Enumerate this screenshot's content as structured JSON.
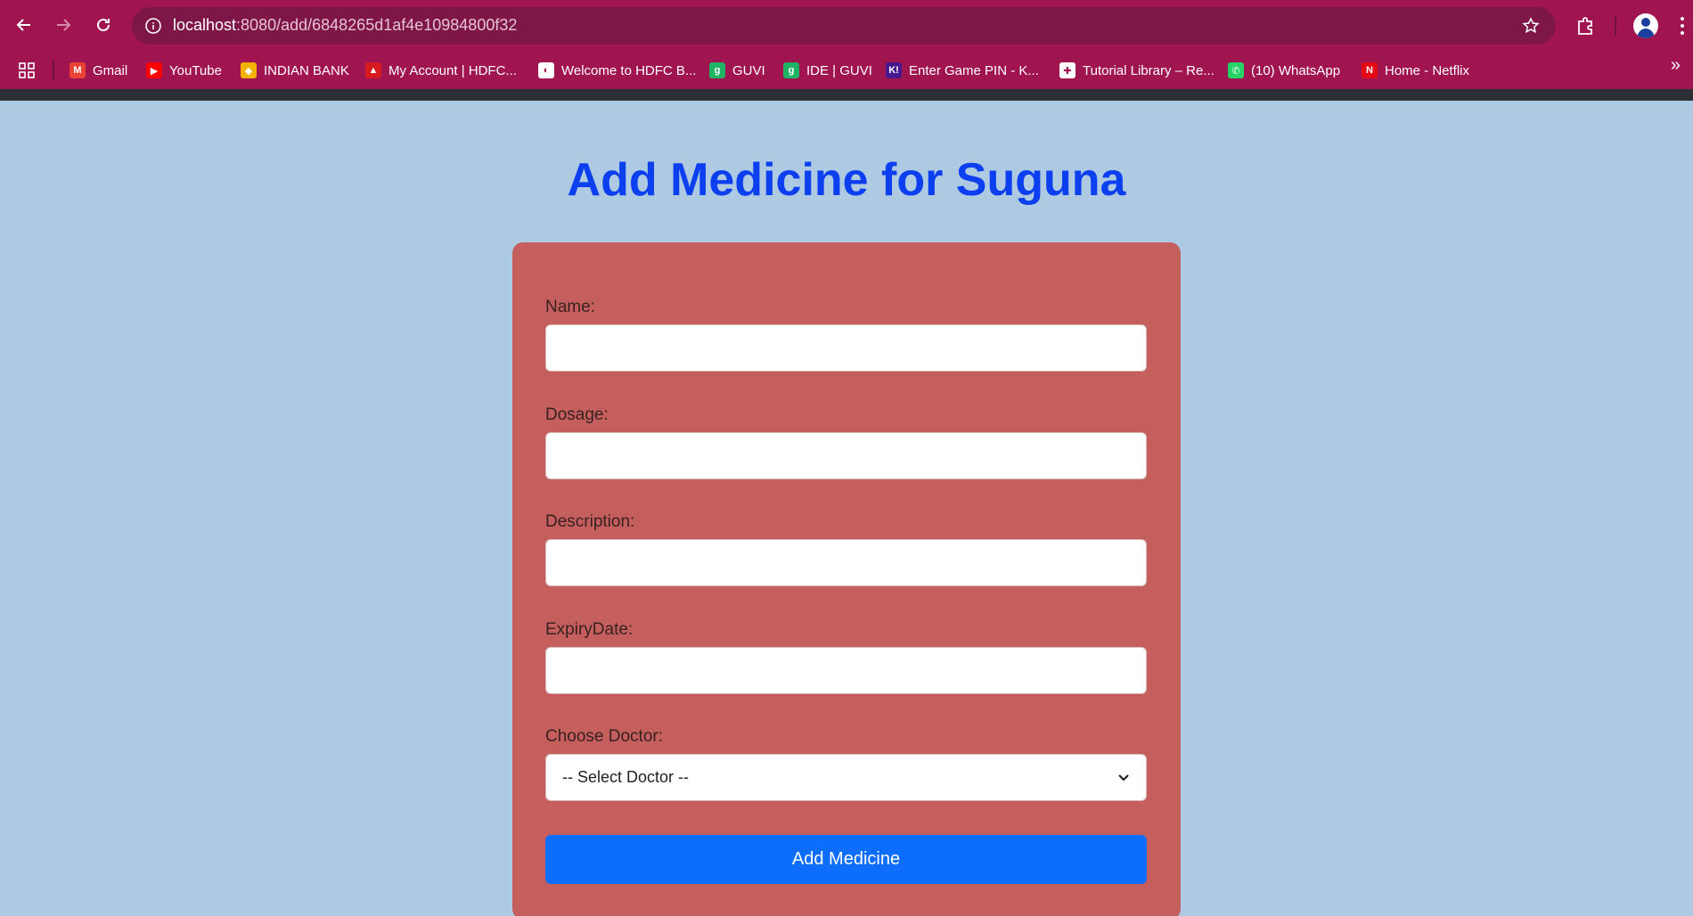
{
  "browser": {
    "url_host": "localhost",
    "url_rest": ":8080/add/6848265d1af4e10984800f32",
    "bookmarks": [
      {
        "label": "Gmail",
        "icon": "gmail-icon",
        "color": "#ea4335",
        "glyph": "M"
      },
      {
        "label": "YouTube",
        "icon": "youtube-icon",
        "color": "#ff0000",
        "glyph": "▶"
      },
      {
        "label": "INDIAN BANK",
        "icon": "indian-bank-icon",
        "color": "#f2b300",
        "glyph": "◆"
      },
      {
        "label": "My Account | HDFC...",
        "icon": "hdfc-icon",
        "color": "#d71920",
        "glyph": "▲"
      },
      {
        "label": "Welcome to HDFC B...",
        "icon": "globe-icon",
        "color": "#ffffff",
        "glyph": "◐"
      },
      {
        "label": "GUVI",
        "icon": "guvi-icon",
        "color": "#1fb463",
        "glyph": "g"
      },
      {
        "label": "IDE | GUVI",
        "icon": "guvi-icon",
        "color": "#1fb463",
        "glyph": "g"
      },
      {
        "label": "Enter Game PIN - K...",
        "icon": "kahoot-icon",
        "color": "#46178f",
        "glyph": "K!"
      },
      {
        "label": "Tutorial Library – Re...",
        "icon": "tutorial-icon",
        "color": "#ffffff",
        "glyph": "✚"
      },
      {
        "label": "(10) WhatsApp",
        "icon": "whatsapp-icon",
        "color": "#25d366",
        "glyph": "✆"
      },
      {
        "label": "Home - Netflix",
        "icon": "netflix-icon",
        "color": "#e50914",
        "glyph": "N"
      }
    ]
  },
  "page": {
    "title": "Add Medicine for Suguna",
    "form": {
      "name_label": "Name:",
      "dosage_label": "Dosage:",
      "description_label": "Description:",
      "expiry_label": "ExpiryDate:",
      "doctor_label": "Choose Doctor:",
      "doctor_selected": "-- Select Doctor --",
      "submit_label": "Add Medicine"
    }
  }
}
